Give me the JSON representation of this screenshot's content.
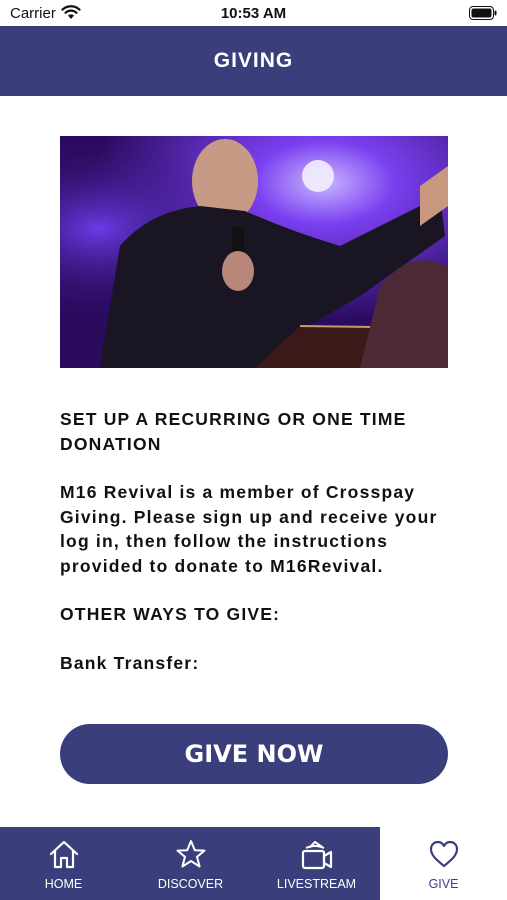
{
  "status_bar": {
    "carrier": "Carrier",
    "time": "10:53 AM"
  },
  "header": {
    "title": "GIVING"
  },
  "hero": {
    "icon": "hero-photo",
    "description_color": "#5b2bd6"
  },
  "content": {
    "heading": "SET UP A RECURRING OR ONE TIME DONATION",
    "paragraph": "M16 Revival is a member of Crosspay Giving. Please sign up and receive your log in, then follow the instructions provided to donate to M16Revival.",
    "other_ways": "OTHER WAYS TO GIVE:",
    "bank_transfer": "Bank Transfer:"
  },
  "give_button": {
    "label": "GIVE NOW"
  },
  "tabbar": {
    "tabs": [
      {
        "label": "HOME",
        "icon": "home-icon",
        "active": false
      },
      {
        "label": "DISCOVER",
        "icon": "star-icon",
        "active": false
      },
      {
        "label": "LIVESTREAM",
        "icon": "livestream-icon",
        "active": false
      },
      {
        "label": "GIVE",
        "icon": "heart-icon",
        "active": true
      }
    ]
  },
  "colors": {
    "brand": "#3a3f7c",
    "background": "#ffffff",
    "text": "#111111"
  }
}
